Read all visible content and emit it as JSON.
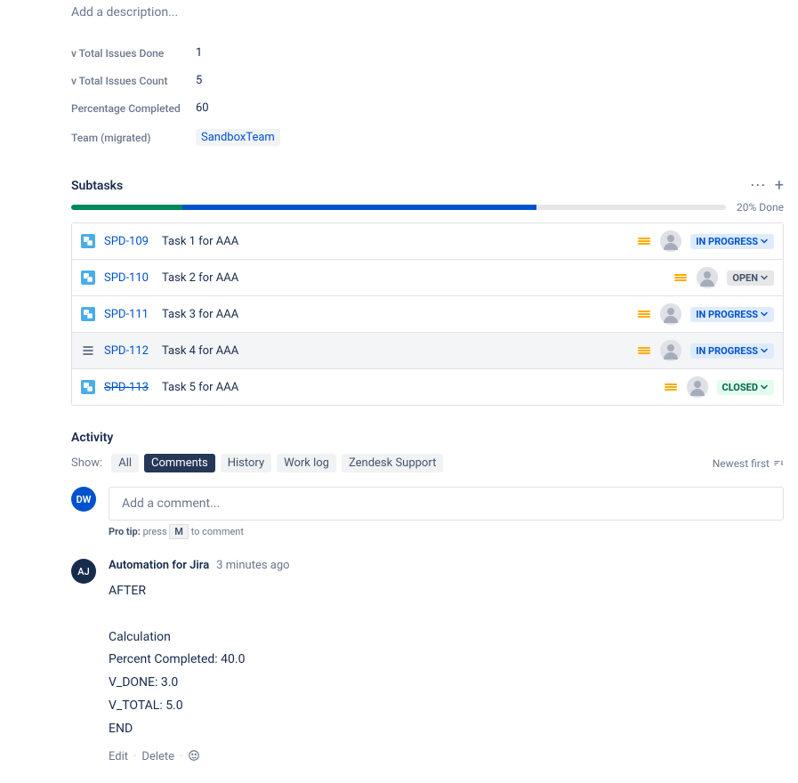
{
  "description": {
    "placeholder": "Add a description..."
  },
  "fields": [
    {
      "label": "v Total Issues Done",
      "value": "1"
    },
    {
      "label": "v Total Issues Count",
      "value": "5"
    },
    {
      "label": "Percentage Completed",
      "value": "60"
    },
    {
      "label": "Team (migrated)",
      "value": "SandboxTeam",
      "link": true
    }
  ],
  "subtasks": {
    "title": "Subtasks",
    "progress": {
      "done_pct": 17,
      "inprogress_pct": 54,
      "label": "20% Done"
    },
    "items": [
      {
        "key": "SPD-109",
        "summary": "Task 1 for AAA",
        "status": "IN PROGRESS",
        "statusType": "inprogress",
        "icon": "subtask",
        "priority": "medium"
      },
      {
        "key": "SPD-110",
        "summary": "Task 2 for AAA",
        "status": "OPEN",
        "statusType": "open",
        "icon": "subtask",
        "priority": "medium"
      },
      {
        "key": "SPD-111",
        "summary": "Task 3 for AAA",
        "status": "IN PROGRESS",
        "statusType": "inprogress",
        "icon": "subtask",
        "priority": "medium"
      },
      {
        "key": "SPD-112",
        "summary": "Task 4 for AAA",
        "status": "IN PROGRESS",
        "statusType": "inprogress",
        "icon": "list",
        "priority": "medium",
        "highlighted": true
      },
      {
        "key": "SPD-113",
        "summary": "Task 5 for AAA",
        "status": "CLOSED",
        "statusType": "closed",
        "icon": "subtask",
        "priority": "medium",
        "struck": true
      }
    ]
  },
  "activity": {
    "title": "Activity",
    "show_label": "Show:",
    "tabs": [
      "All",
      "Comments",
      "History",
      "Work log",
      "Zendesk Support"
    ],
    "active_tab": "Comments",
    "sort": "Newest first",
    "comment_input": {
      "placeholder": "Add a comment...",
      "avatar": "DW"
    },
    "pro_tip": {
      "prefix": "Pro tip:",
      "press": "press",
      "key": "M",
      "suffix": "to comment"
    },
    "comments": [
      {
        "avatar": "AJ",
        "author": "Automation for Jira",
        "time": "3 minutes ago",
        "body": [
          "AFTER",
          "",
          "Calculation",
          "Percent Completed: 40.0",
          "V_DONE: 3.0",
          "V_TOTAL: 5.0",
          "END"
        ],
        "actions": {
          "edit": "Edit",
          "delete": "Delete"
        }
      }
    ]
  }
}
